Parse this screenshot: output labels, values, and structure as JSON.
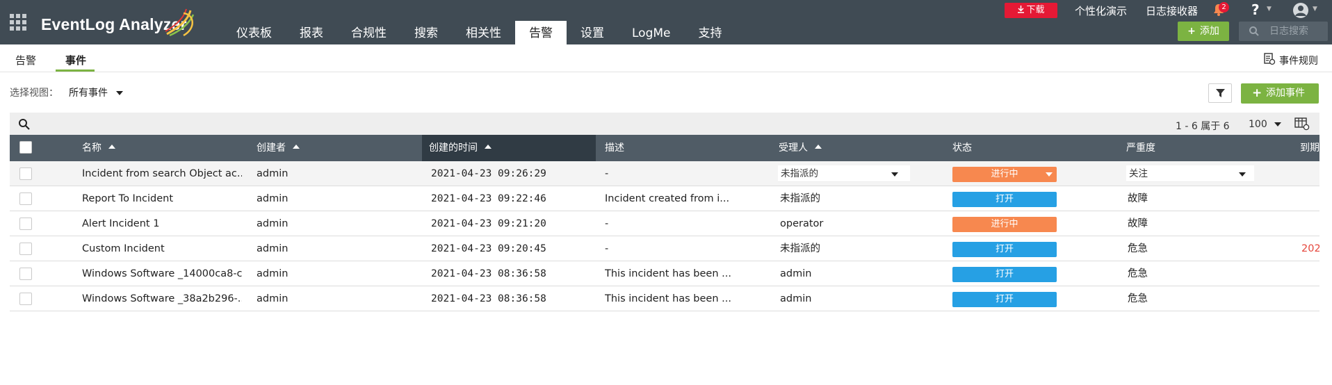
{
  "app": {
    "logo": "EventLog Analyzer",
    "nav": [
      "仪表板",
      "报表",
      "合规性",
      "搜索",
      "相关性",
      "告警",
      "设置",
      "LogMe",
      "支持"
    ],
    "nav_active_index": 5,
    "download": "下载",
    "personalize_demo": "个性化演示",
    "log_receiver": "日志接收器",
    "notification_count": "2",
    "help": "?",
    "add_button": "添加",
    "log_search_placeholder": "日志搜索"
  },
  "subtabs": {
    "alerts": "告警",
    "incidents": "事件",
    "active": "incidents"
  },
  "rules_link": "事件规则",
  "view": {
    "label": "选择视图：",
    "selected": "所有事件"
  },
  "add_incident": "添加事件",
  "pager": {
    "range": "1 - 6 属于 6",
    "per_page": "100"
  },
  "columns": {
    "name": "名称",
    "creator": "创建者",
    "created_time": "创建的时间",
    "description": "描述",
    "assignee": "受理人",
    "status": "状态",
    "severity": "严重度",
    "due": "到期"
  },
  "rows": [
    {
      "name": "Incident from search Object ac...",
      "creator": "admin",
      "time": "2021-04-23 09:26:29",
      "desc": "-",
      "assignee": "未指派的",
      "status": "进行中",
      "status_type": "progress",
      "severity": "关注",
      "due": ""
    },
    {
      "name": "Report To Incident",
      "creator": "admin",
      "time": "2021-04-23 09:22:46",
      "desc": "Incident created from i...",
      "assignee": "未指派的",
      "status": "打开",
      "status_type": "open",
      "severity": "故障",
      "due": ""
    },
    {
      "name": "Alert Incident 1",
      "creator": "admin",
      "time": "2021-04-23 09:21:20",
      "desc": "-",
      "assignee": "operator",
      "status": "进行中",
      "status_type": "progress",
      "severity": "故障",
      "due": ""
    },
    {
      "name": "Custom Incident",
      "creator": "admin",
      "time": "2021-04-23 09:20:45",
      "desc": "-",
      "assignee": "未指派的",
      "status": "打开",
      "status_type": "open",
      "severity": "危急",
      "due": "202"
    },
    {
      "name": "Windows Software _14000ca8-c...",
      "creator": "admin",
      "time": "2021-04-23 08:36:58",
      "desc": "This incident has been ...",
      "assignee": "admin",
      "status": "打开",
      "status_type": "open",
      "severity": "危急",
      "due": ""
    },
    {
      "name": "Windows Software _38a2b296-...",
      "creator": "admin",
      "time": "2021-04-23 08:36:58",
      "desc": "This incident has been ...",
      "assignee": "admin",
      "status": "打开",
      "status_type": "open",
      "severity": "危急",
      "due": ""
    }
  ],
  "colors": {
    "topbar": "#404b54",
    "accent_green": "#7cb342",
    "status_open": "#26a0e4",
    "status_progress": "#f7884f",
    "danger": "#e51935"
  }
}
